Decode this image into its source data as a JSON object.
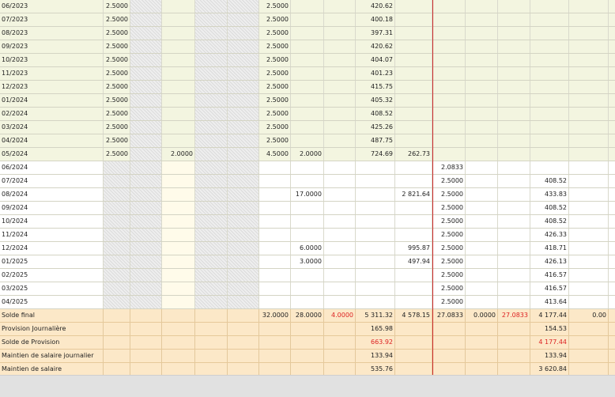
{
  "rows": [
    {
      "type": "past",
      "c0": "06/2023",
      "c1": "2.5000",
      "c2": "",
      "c4": "2.5000",
      "c5": "",
      "c6": "420.62",
      "c7": "",
      "c8": "",
      "c9": "",
      "c10": "",
      "c11": "",
      "c12": ""
    },
    {
      "type": "past",
      "c0": "07/2023",
      "c1": "2.5000",
      "c2": "",
      "c4": "2.5000",
      "c5": "",
      "c6": "400.18",
      "c7": "",
      "c8": "",
      "c9": "",
      "c10": "",
      "c11": "",
      "c12": ""
    },
    {
      "type": "past",
      "c0": "08/2023",
      "c1": "2.5000",
      "c2": "",
      "c4": "2.5000",
      "c5": "",
      "c6": "397.31",
      "c7": "",
      "c8": "",
      "c9": "",
      "c10": "",
      "c11": "",
      "c12": ""
    },
    {
      "type": "past",
      "c0": "09/2023",
      "c1": "2.5000",
      "c2": "",
      "c4": "2.5000",
      "c5": "",
      "c6": "420.62",
      "c7": "",
      "c8": "",
      "c9": "",
      "c10": "",
      "c11": "",
      "c12": ""
    },
    {
      "type": "past",
      "c0": "10/2023",
      "c1": "2.5000",
      "c2": "",
      "c4": "2.5000",
      "c5": "",
      "c6": "404.07",
      "c7": "",
      "c8": "",
      "c9": "",
      "c10": "",
      "c11": "",
      "c12": ""
    },
    {
      "type": "past",
      "c0": "11/2023",
      "c1": "2.5000",
      "c2": "",
      "c4": "2.5000",
      "c5": "",
      "c6": "401.23",
      "c7": "",
      "c8": "",
      "c9": "",
      "c10": "",
      "c11": "",
      "c12": ""
    },
    {
      "type": "past",
      "c0": "12/2023",
      "c1": "2.5000",
      "c2": "",
      "c4": "2.5000",
      "c5": "",
      "c6": "415.75",
      "c7": "",
      "c8": "",
      "c9": "",
      "c10": "",
      "c11": "",
      "c12": ""
    },
    {
      "type": "past",
      "c0": "01/2024",
      "c1": "2.5000",
      "c2": "",
      "c4": "2.5000",
      "c5": "",
      "c6": "405.32",
      "c7": "",
      "c8": "",
      "c9": "",
      "c10": "",
      "c11": "",
      "c12": ""
    },
    {
      "type": "past",
      "c0": "02/2024",
      "c1": "2.5000",
      "c2": "",
      "c4": "2.5000",
      "c5": "",
      "c6": "408.52",
      "c7": "",
      "c8": "",
      "c9": "",
      "c10": "",
      "c11": "",
      "c12": ""
    },
    {
      "type": "past",
      "c0": "03/2024",
      "c1": "2.5000",
      "c2": "",
      "c4": "2.5000",
      "c5": "",
      "c6": "425.26",
      "c7": "",
      "c8": "",
      "c9": "",
      "c10": "",
      "c11": "",
      "c12": ""
    },
    {
      "type": "past",
      "c0": "04/2024",
      "c1": "2.5000",
      "c2": "",
      "c4": "2.5000",
      "c5": "",
      "c6": "487.75",
      "c7": "",
      "c8": "",
      "c9": "",
      "c10": "",
      "c11": "",
      "c12": ""
    },
    {
      "type": "past",
      "c0": "05/2024",
      "c1": "2.5000",
      "c2": "2.0000",
      "c4": "4.5000",
      "c5": "2.0000",
      "c6": "724.69",
      "c7": "262.73",
      "c8": "",
      "c9": "",
      "c10": "",
      "c11": "",
      "c12": ""
    },
    {
      "type": "future",
      "c0": "06/2024",
      "c1": "",
      "c2": "",
      "c4": "",
      "c5": "",
      "c6": "",
      "c7": "",
      "c8": "2.0833",
      "c9": "",
      "c10": "",
      "c11": "",
      "c12": ""
    },
    {
      "type": "future",
      "c0": "07/2024",
      "c1": "",
      "c2": "",
      "c4": "",
      "c5": "",
      "c6": "",
      "c7": "",
      "c8": "2.5000",
      "c9": "",
      "c10": "",
      "c11": "408.52",
      "c12": ""
    },
    {
      "type": "future",
      "c0": "08/2024",
      "c1": "",
      "c2": "",
      "c4": "",
      "c5": "17.0000",
      "c6": "",
      "c7": "2 821.64",
      "c8": "2.5000",
      "c9": "",
      "c10": "",
      "c11": "433.83",
      "c12": ""
    },
    {
      "type": "future",
      "c0": "09/2024",
      "c1": "",
      "c2": "",
      "c4": "",
      "c5": "",
      "c6": "",
      "c7": "",
      "c8": "2.5000",
      "c9": "",
      "c10": "",
      "c11": "408.52",
      "c12": ""
    },
    {
      "type": "future",
      "c0": "10/2024",
      "c1": "",
      "c2": "",
      "c4": "",
      "c5": "",
      "c6": "",
      "c7": "",
      "c8": "2.5000",
      "c9": "",
      "c10": "",
      "c11": "408.52",
      "c12": ""
    },
    {
      "type": "future",
      "c0": "11/2024",
      "c1": "",
      "c2": "",
      "c4": "",
      "c5": "",
      "c6": "",
      "c7": "",
      "c8": "2.5000",
      "c9": "",
      "c10": "",
      "c11": "426.33",
      "c12": ""
    },
    {
      "type": "future",
      "c0": "12/2024",
      "c1": "",
      "c2": "",
      "c4": "",
      "c5": "6.0000",
      "c6": "",
      "c7": "995.87",
      "c8": "2.5000",
      "c9": "",
      "c10": "",
      "c11": "418.71",
      "c12": ""
    },
    {
      "type": "future",
      "c0": "01/2025",
      "c1": "",
      "c2": "",
      "c4": "",
      "c5": "3.0000",
      "c6": "",
      "c7": "497.94",
      "c8": "2.5000",
      "c9": "",
      "c10": "",
      "c11": "426.13",
      "c12": ""
    },
    {
      "type": "future",
      "c0": "02/2025",
      "c1": "",
      "c2": "",
      "c4": "",
      "c5": "",
      "c6": "",
      "c7": "",
      "c8": "2.5000",
      "c9": "",
      "c10": "",
      "c11": "416.57",
      "c12": ""
    },
    {
      "type": "future",
      "c0": "03/2025",
      "c1": "",
      "c2": "",
      "c4": "",
      "c5": "",
      "c6": "",
      "c7": "",
      "c8": "2.5000",
      "c9": "",
      "c10": "",
      "c11": "416.57",
      "c12": ""
    },
    {
      "type": "future",
      "c0": "04/2025",
      "c1": "",
      "c2": "",
      "c4": "",
      "c5": "",
      "c6": "",
      "c7": "",
      "c8": "2.5000",
      "c9": "",
      "c10": "",
      "c11": "413.64",
      "c12": ""
    }
  ],
  "summary": [
    {
      "c0": "Solde final",
      "c4": "32.0000",
      "c5": "28.0000",
      "c5b": "4.0000",
      "c6": "5 311.32",
      "c7": "4 578.15",
      "c8": "27.0833",
      "c9": "0.0000",
      "c10": "27.0833",
      "c11": "4 177.44",
      "c12": "0.00"
    },
    {
      "c0": "Provision Journalière",
      "c4": "",
      "c5": "",
      "c5b": "",
      "c6": "165.98",
      "c7": "",
      "c8": "",
      "c9": "",
      "c10": "",
      "c11": "154.53",
      "c12": ""
    },
    {
      "c0": "Solde de Provision",
      "c4": "",
      "c5": "",
      "c5b": "",
      "c6": "663.92",
      "c7": "",
      "c8": "",
      "c9": "",
      "c10": "",
      "c11": "4 177.44",
      "c12": ""
    },
    {
      "c0": "Maintien de salaire journalier",
      "c4": "",
      "c5": "",
      "c5b": "",
      "c6": "133.94",
      "c7": "",
      "c8": "",
      "c9": "",
      "c10": "",
      "c11": "133.94",
      "c12": ""
    },
    {
      "c0": "Maintien de salaire",
      "c4": "",
      "c5": "",
      "c5b": "",
      "c6": "535.76",
      "c7": "",
      "c8": "",
      "c9": "",
      "c10": "",
      "c11": "3 620.84",
      "c12": ""
    }
  ],
  "colors": {
    "past_row": "#f3f5e0",
    "summary_row": "#fce8c8",
    "negative": "#dd2222",
    "today_line": "#cc2a2a"
  }
}
